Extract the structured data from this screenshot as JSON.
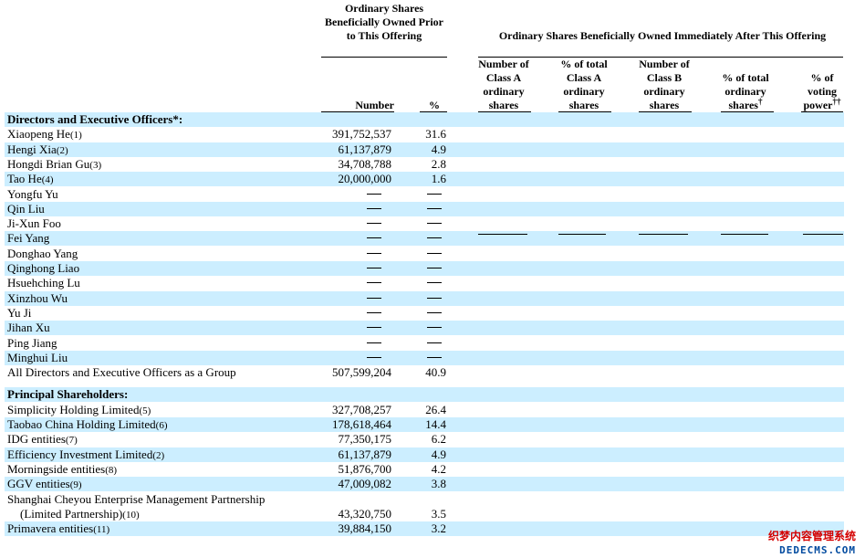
{
  "header": {
    "prior_group": "Ordinary Shares Beneficially Owned Prior to This Offering",
    "after_group": "Ordinary Shares Beneficially Owned Immediately After This Offering",
    "col_number": "Number",
    "col_pct": "%",
    "col_class_a": "Number of Class A ordinary shares",
    "col_pct_class_a": "% of total Class A ordinary shares",
    "col_class_b": "Number of Class B ordinary shares",
    "col_pct_total": "% of total ordinary shares",
    "col_pct_total_mark": "†",
    "col_voting": "% of voting power",
    "col_voting_mark": "††"
  },
  "rows": [
    {
      "type": "section",
      "name": "Directors and Executive Officers*:"
    },
    {
      "name": "Xiaopeng He",
      "fn": "(1)",
      "number": "391,752,537",
      "pct": "31.6"
    },
    {
      "name": "Hengi Xia",
      "fn": "(2)",
      "number": "61,137,879",
      "pct": "4.9"
    },
    {
      "name": "Hongdi Brian Gu",
      "fn": "(3)",
      "number": "34,708,788",
      "pct": "2.8"
    },
    {
      "name": "Tao He",
      "fn": "(4)",
      "number": "20,000,000",
      "pct": "1.6"
    },
    {
      "name": "Yongfu Yu",
      "dash": true
    },
    {
      "name": "Qin Liu",
      "dash": true
    },
    {
      "name": "Ji-Xun Foo",
      "dash": true
    },
    {
      "name": "Fei Yang",
      "dash": true
    },
    {
      "name": "Donghao Yang",
      "dash": true
    },
    {
      "name": "Qinghong Liao",
      "dash": true
    },
    {
      "name": "Hsuehching Lu",
      "dash": true
    },
    {
      "name": "Xinzhou Wu",
      "dash": true
    },
    {
      "name": "Yu Ji",
      "dash": true
    },
    {
      "name": "Jihan Xu",
      "dash": true
    },
    {
      "name": "Ping Jiang",
      "dash": true
    },
    {
      "name": "Minghui Liu",
      "dash": true
    },
    {
      "name": "All Directors and Executive Officers as a Group",
      "number": "507,599,204",
      "pct": "40.9"
    },
    {
      "type": "spacer"
    },
    {
      "type": "section",
      "name": "Principal Shareholders:"
    },
    {
      "name": "Simplicity Holding Limited",
      "fn": "(5)",
      "number": "327,708,257",
      "pct": "26.4"
    },
    {
      "name": "Taobao China Holding Limited",
      "fn": "(6)",
      "number": "178,618,464",
      "pct": "14.4"
    },
    {
      "name": "IDG entities",
      "fn": "(7)",
      "number": "77,350,175",
      "pct": "6.2"
    },
    {
      "name": "Efficiency Investment Limited",
      "fn": "(2)",
      "number": "61,137,879",
      "pct": "4.9"
    },
    {
      "name": "Morningside entities",
      "fn": "(8)",
      "number": "51,876,700",
      "pct": "4.2"
    },
    {
      "name": "GGV entities",
      "fn": "(9)",
      "number": "47,009,082",
      "pct": "3.8"
    },
    {
      "type": "wrap",
      "name": "Shanghai Cheyou Enterprise Management Partnership",
      "name2": "(Limited Partnership)",
      "fn": "(10)",
      "number": "43,320,750",
      "pct": "3.5"
    },
    {
      "name": "Primavera entities",
      "fn": "(11)",
      "number": "39,884,150",
      "pct": "3.2"
    }
  ],
  "watermark": {
    "line1": "织梦内容管理系统",
    "line2": "DEDECMS.COM"
  }
}
